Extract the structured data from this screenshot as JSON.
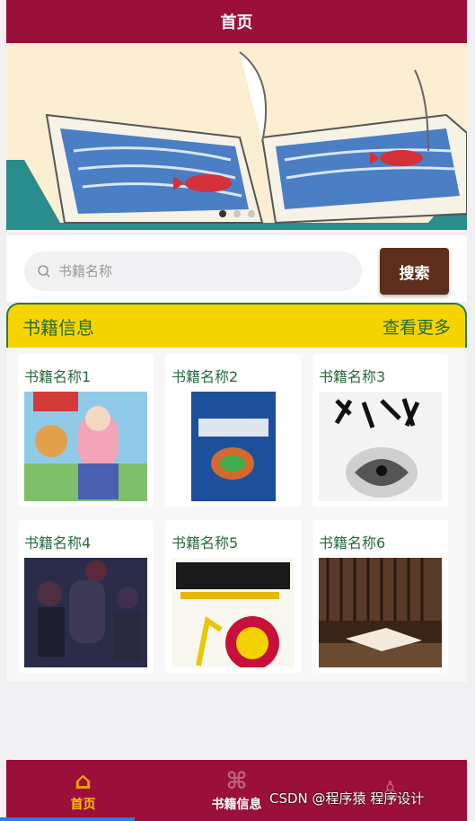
{
  "header": {
    "title": "首页"
  },
  "banner": {
    "slides": 3,
    "active_slide": 0
  },
  "search": {
    "placeholder": "书籍名称",
    "button_label": "搜索"
  },
  "section": {
    "title": "书籍信息",
    "more_label": "查看更多"
  },
  "books": [
    {
      "name": "书籍名称1"
    },
    {
      "name": "书籍名称2"
    },
    {
      "name": "书籍名称3"
    },
    {
      "name": "书籍名称4"
    },
    {
      "name": "书籍名称5"
    },
    {
      "name": "书籍名称6"
    }
  ],
  "footer": {
    "tabs": [
      {
        "label": "首页",
        "icon": "home-icon",
        "active": true
      },
      {
        "label": "书籍信息",
        "icon": "grid-icon",
        "active": false
      },
      {
        "label": "",
        "icon": "user-icon",
        "active": false
      }
    ]
  },
  "watermark": "CSDN @程序猿 程序设计",
  "colors": {
    "primary": "#9b0f3b",
    "accent": "#f5d400",
    "button": "#5c2f1c",
    "label": "#2a6a40"
  }
}
